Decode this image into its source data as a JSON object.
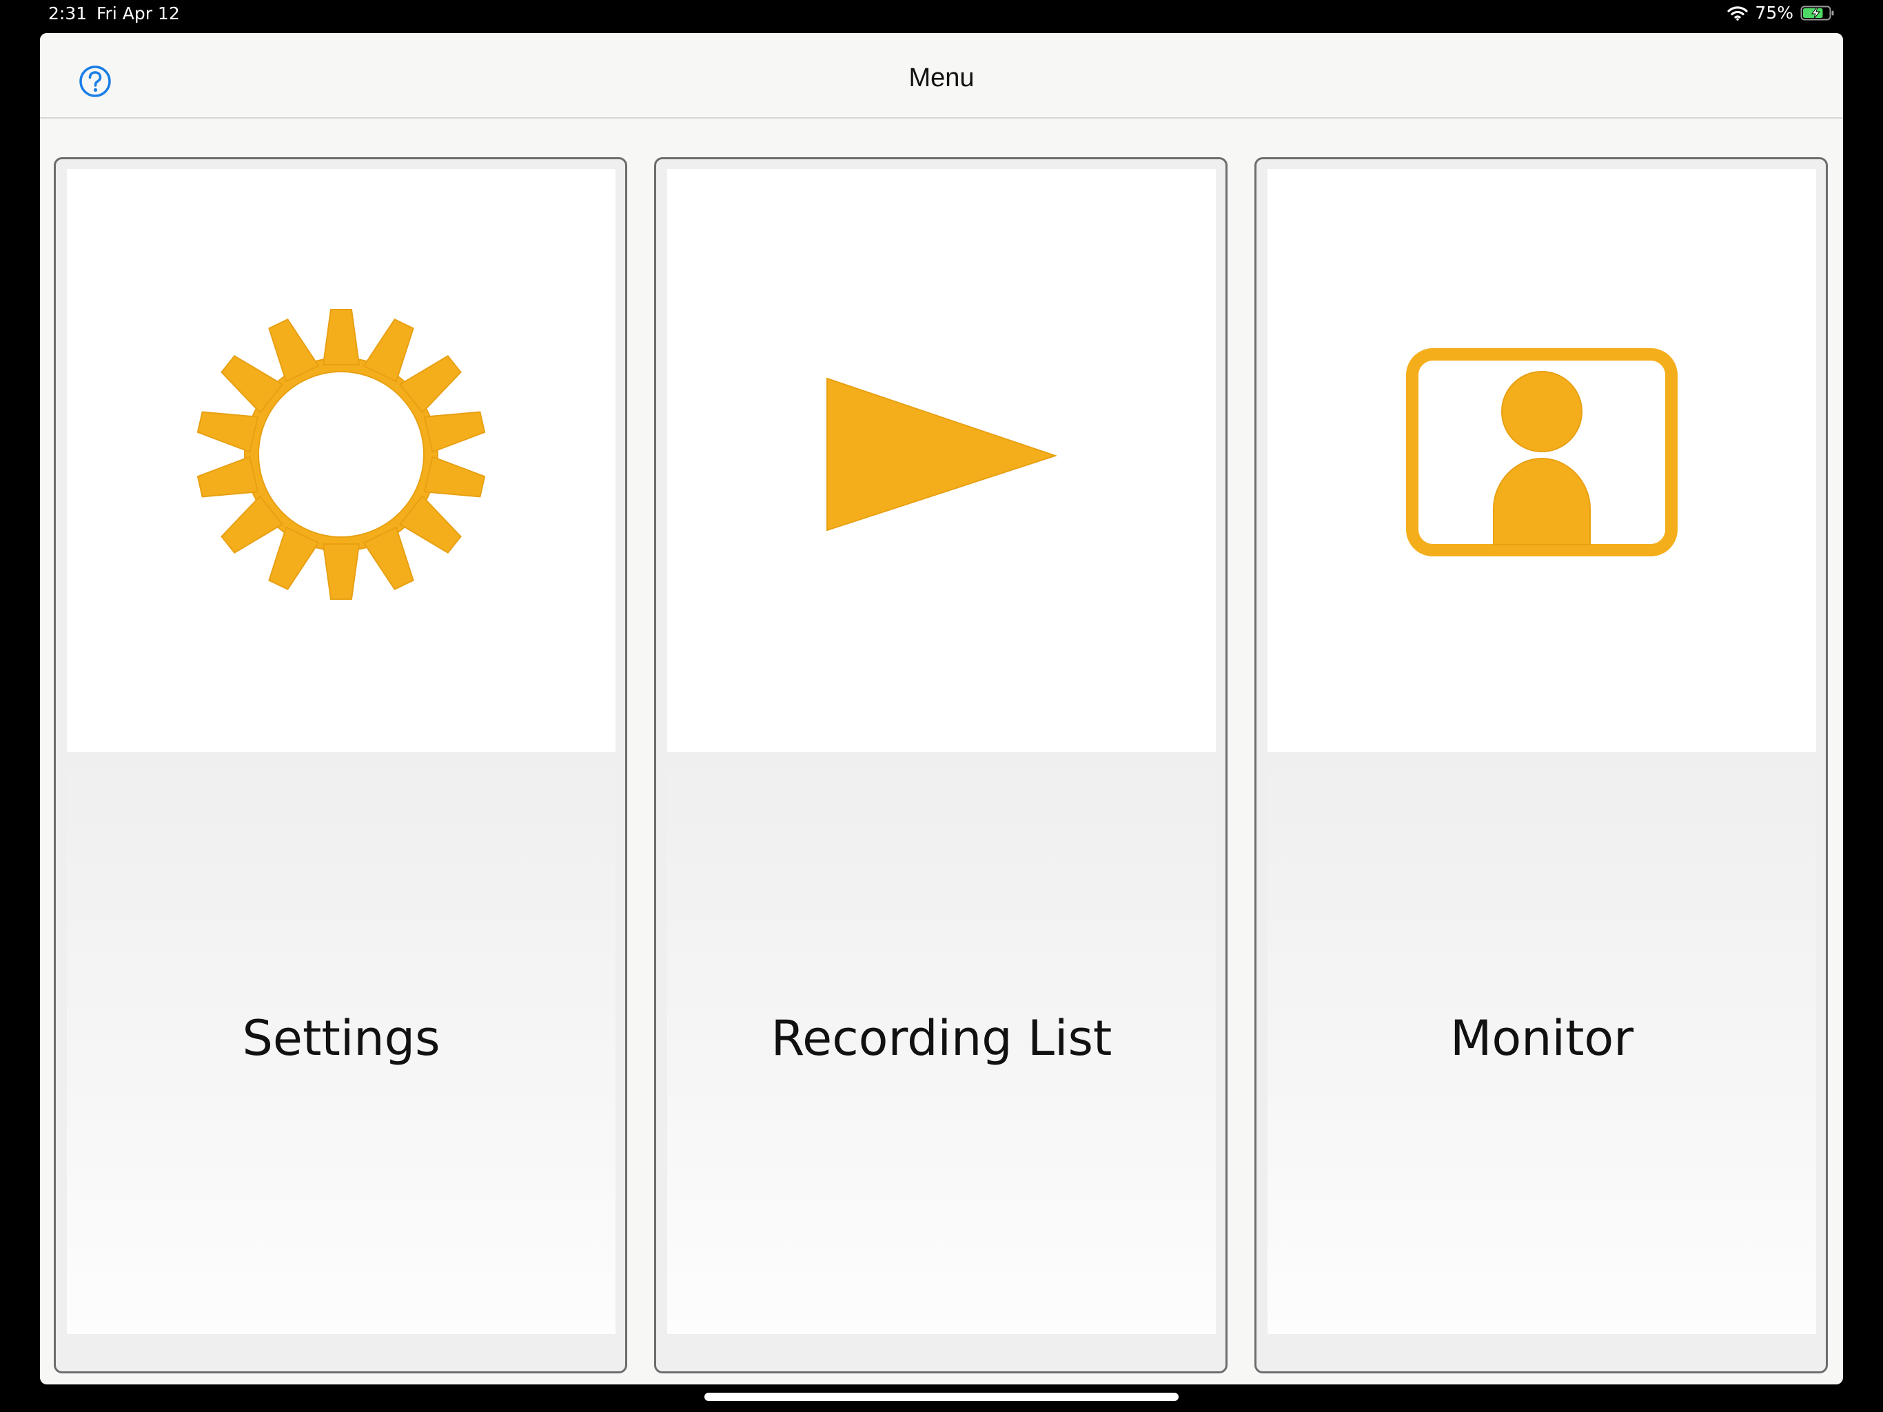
{
  "status_bar": {
    "time": "2:31",
    "date": "Fri Apr 12",
    "battery_percent": "75%",
    "battery_level": 0.75,
    "wifi_icon": "wifi-icon",
    "battery_icon": "battery-charging-icon"
  },
  "nav": {
    "title": "Menu",
    "help_icon": "help-circle-icon"
  },
  "menu_items": [
    {
      "label": "Settings",
      "icon": "gear-icon"
    },
    {
      "label": "Recording List",
      "icon": "play-icon"
    },
    {
      "label": "Monitor",
      "icon": "person-monitor-icon"
    }
  ],
  "colors": {
    "accent": "#f5ae1b",
    "help_blue": "#1a7ee6",
    "battery_green": "#4cd964"
  }
}
